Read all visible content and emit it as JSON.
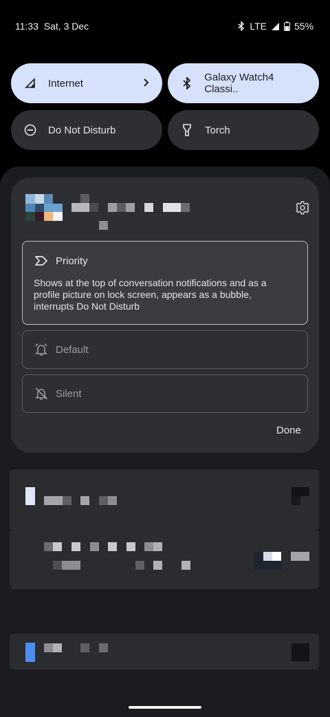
{
  "status": {
    "time": "11:33",
    "date": "Sat, 3 Dec",
    "network": "LTE",
    "battery": "55%"
  },
  "quick_tiles": [
    {
      "label": "Internet",
      "icon": "signal-icon",
      "active": true
    },
    {
      "label": "Galaxy Watch4 Classi..",
      "icon": "bluetooth-icon",
      "active": true
    },
    {
      "label": "Do Not Disturb",
      "icon": "dnd-icon",
      "active": false
    },
    {
      "label": "Torch",
      "icon": "torch-icon",
      "active": false
    }
  ],
  "notification_card": {
    "options": [
      {
        "label": "Priority",
        "icon": "priority-icon",
        "selected": true,
        "description": "Shows at the top of conversation notifications and as a profile picture on lock screen, appears as a bubble, interrupts Do Not Disturb"
      },
      {
        "label": "Default",
        "icon": "bell-icon",
        "selected": false
      },
      {
        "label": "Silent",
        "icon": "bell-off-icon",
        "selected": false
      }
    ],
    "done_label": "Done"
  },
  "colors": {
    "active_tile": "#d6e1fb",
    "inactive_tile": "#2e2f33",
    "card": "#2e2f34",
    "shade": "#1b1c1f"
  }
}
